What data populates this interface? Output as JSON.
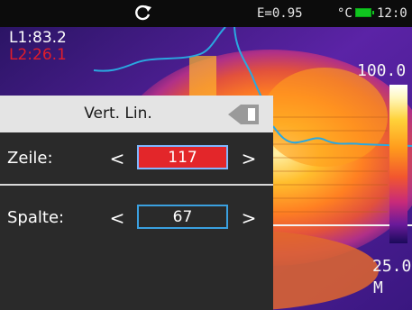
{
  "status_bar": {
    "emissivity": "E=0.95",
    "unit": "°C",
    "time": "12:0"
  },
  "readouts": {
    "l1": "L1:83.2",
    "l2": "L2:26.1"
  },
  "scale": {
    "max": "100.0",
    "min": "25.0",
    "mode": "M"
  },
  "panel": {
    "title": "Vert. Lin.",
    "rows": [
      {
        "label": "Zeile:",
        "value": "117",
        "prev": "<",
        "next": ">"
      },
      {
        "label": "Spalte:",
        "value": "67",
        "prev": "<",
        "next": ">"
      }
    ]
  },
  "colors": {
    "selected_value_bg": "#e3262a",
    "battery": "#10c51f",
    "l2_text": "#e11d2a",
    "profile_line": "#2aa8e0"
  },
  "icons": [
    "refresh-icon",
    "battery-icon",
    "back-icon"
  ]
}
